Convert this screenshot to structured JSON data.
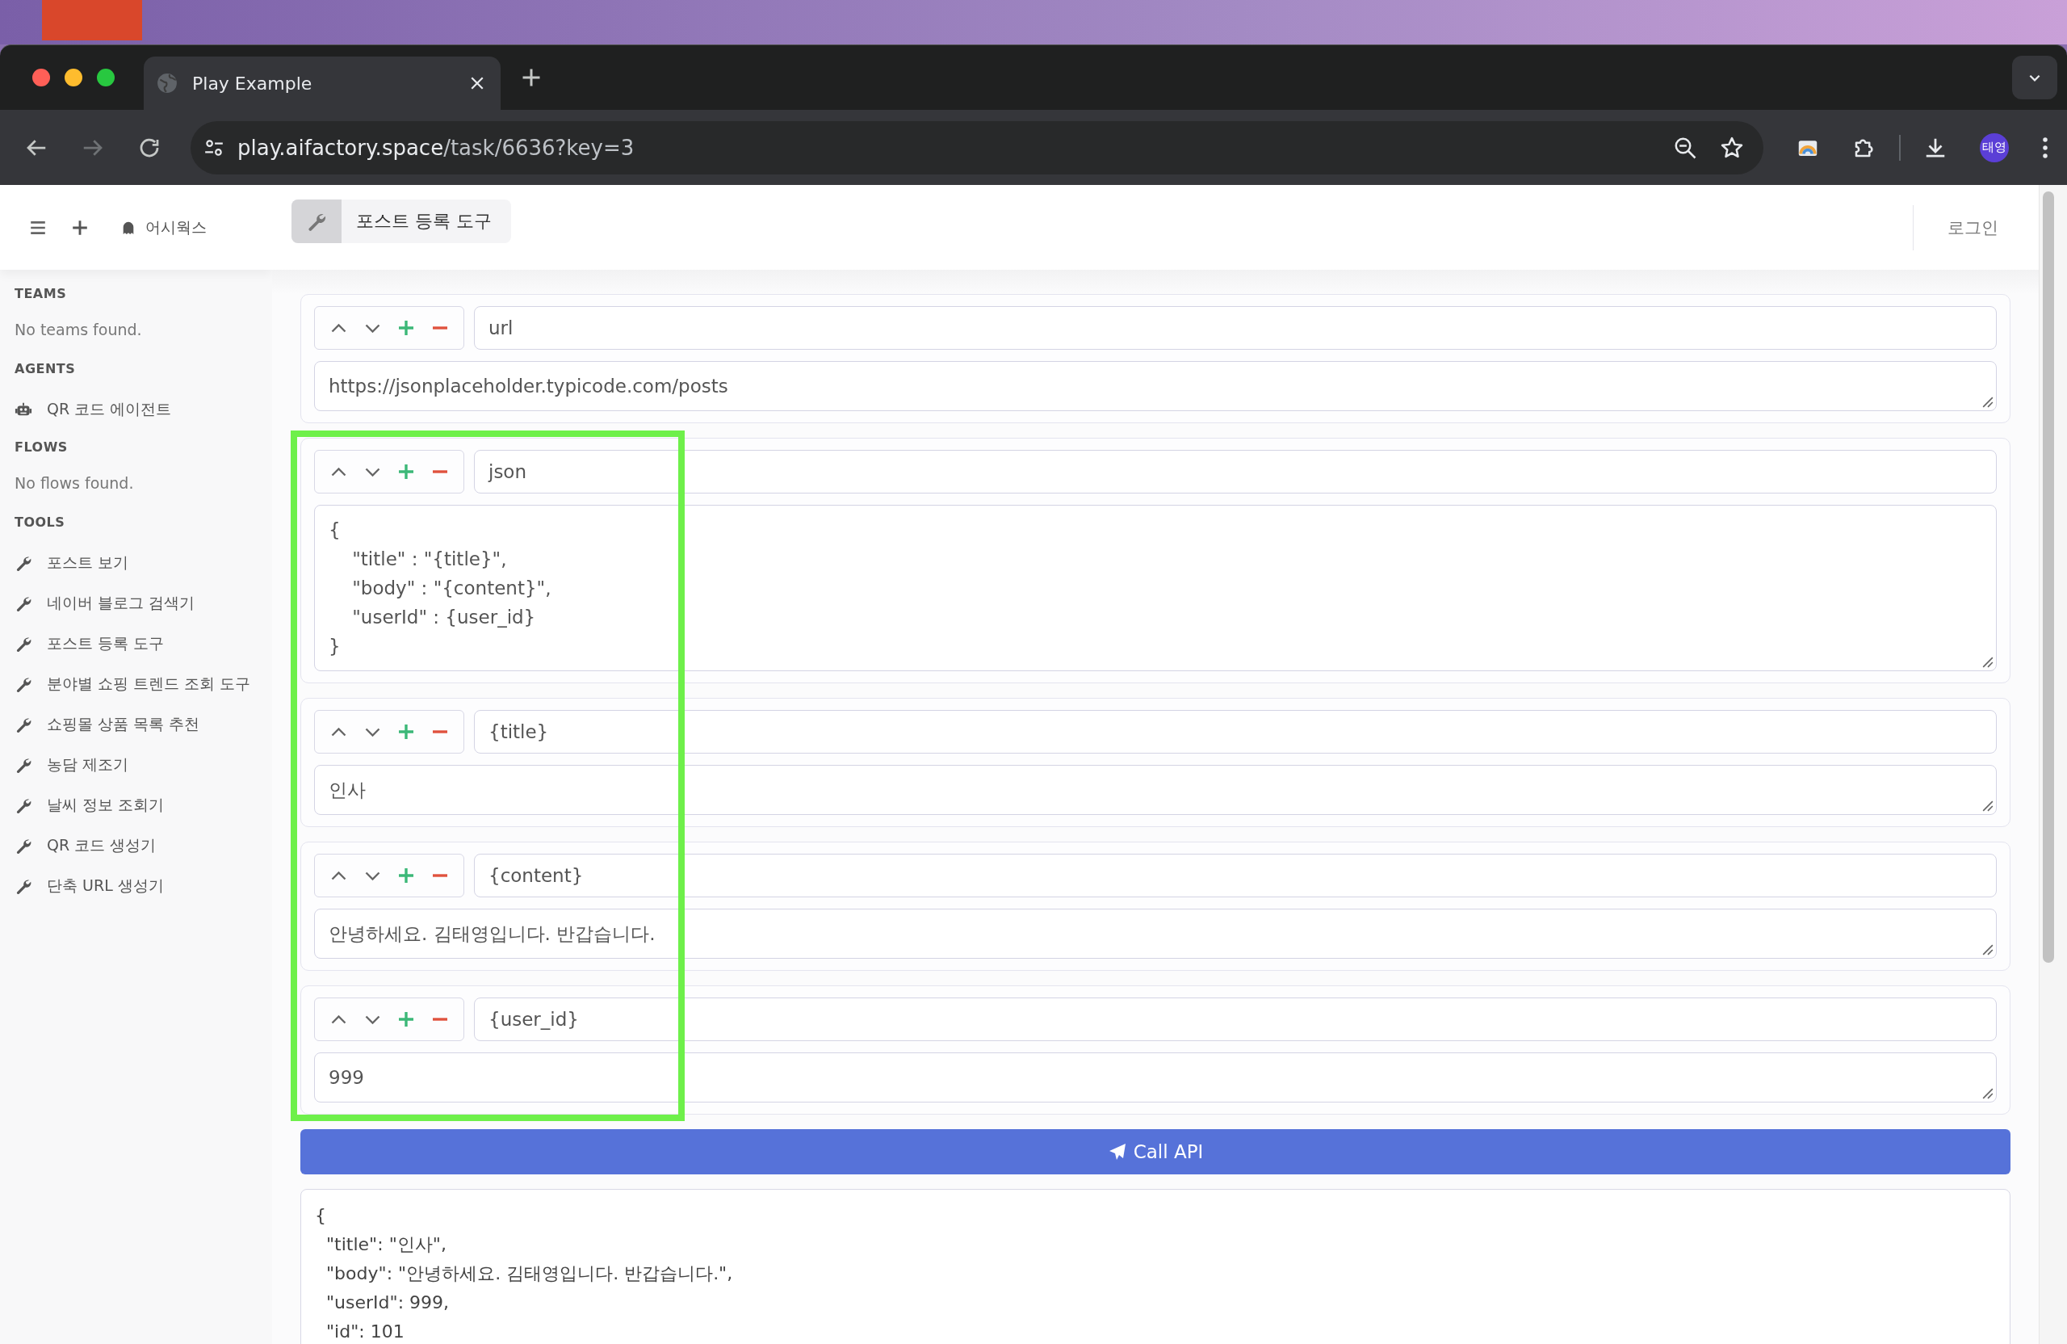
{
  "browser": {
    "tab": {
      "title": "Play Example",
      "selected": true
    },
    "back": {
      "disabled": false
    },
    "forward": {
      "disabled": true
    },
    "address": {
      "domain": "play.aifactory.space",
      "path": "/task/6636?key=3"
    },
    "profile": "태영"
  },
  "sidebar": {
    "workspace": "어시웍스",
    "sections": [
      {
        "heading": "TEAMS",
        "empty": "No teams found."
      },
      {
        "heading": "AGENTS",
        "items": [
          {
            "label": "QR 코드 에이전트",
            "kind": "agent"
          }
        ]
      },
      {
        "heading": "FLOWS",
        "empty": "No flows found."
      },
      {
        "heading": "TOOLS",
        "items": [
          {
            "label": "포스트 보기",
            "kind": "tool"
          },
          {
            "label": "네이버 블로그 검색기",
            "kind": "tool"
          },
          {
            "label": "포스트 등록 도구",
            "kind": "tool"
          },
          {
            "label": "분야별 쇼핑 트렌드 조회 도구",
            "kind": "tool"
          },
          {
            "label": "쇼핑몰 상품 목록 추천",
            "kind": "tool"
          },
          {
            "label": "농담 제조기",
            "kind": "tool"
          },
          {
            "label": "날씨 정보 조회기",
            "kind": "tool"
          },
          {
            "label": "QR 코드 생성기",
            "kind": "tool"
          },
          {
            "label": "단축 URL 생성기",
            "kind": "tool"
          }
        ]
      }
    ]
  },
  "header": {
    "tool_title": "포스트 등록 도구",
    "login": "로그인"
  },
  "params": [
    {
      "name": "url",
      "value": "https://jsonplaceholder.typicode.com/posts"
    },
    {
      "name": "json",
      "value": "{\n    \"title\" : \"{title}\",\n    \"body\" : \"{content}\",\n    \"userId\" : {user_id}\n}"
    },
    {
      "name": "{title}",
      "value": "인사"
    },
    {
      "name": "{content}",
      "value": "안녕하세요. 김태영입니다. 반갑습니다."
    },
    {
      "name": "{user_id}",
      "value": "999"
    }
  ],
  "call_button": "Call API",
  "response": "{\n  \"title\": \"인사\",\n  \"body\": \"안녕하세요. 김태영입니다. 반갑습니다.\",\n  \"userId\": 999,\n  \"id\": 101"
}
